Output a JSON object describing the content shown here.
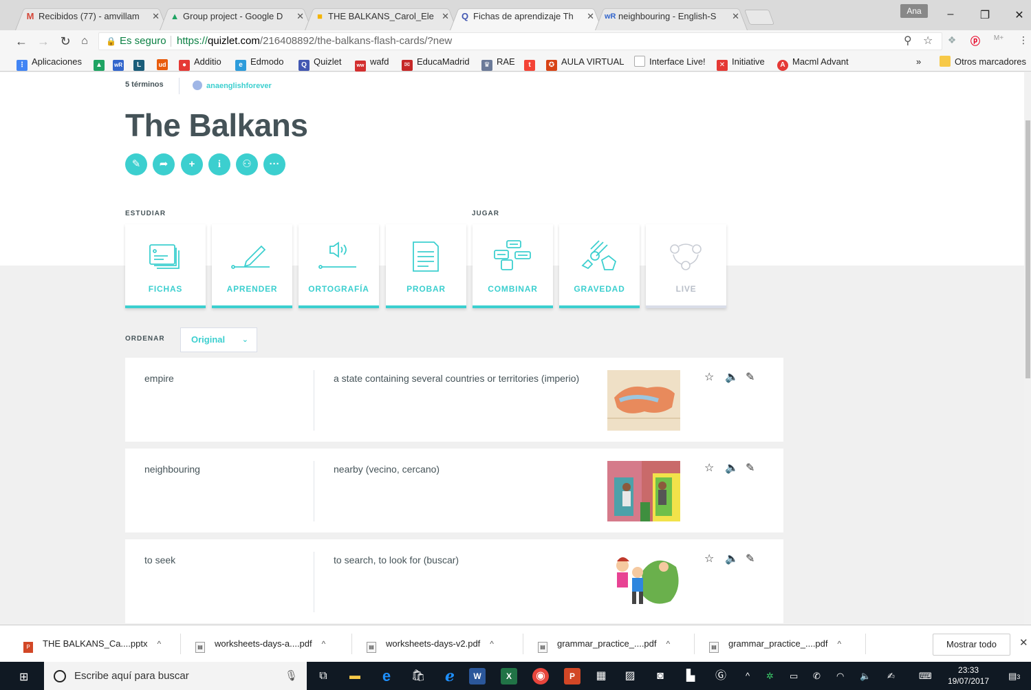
{
  "browser": {
    "tabs": [
      {
        "title": "Recibidos (77) - amvillam",
        "icon": "gmail-icon",
        "color": "#d44638",
        "active": false
      },
      {
        "title": "Group project - Google D",
        "icon": "drive-icon",
        "color": "#1fa463",
        "active": false
      },
      {
        "title": "THE BALKANS_Carol_Elen",
        "icon": "slides-icon",
        "color": "#f4b400",
        "active": false
      },
      {
        "title": "Fichas de aprendizaje Th",
        "icon": "quizlet-icon",
        "color": "#4257b2",
        "active": true
      },
      {
        "title": "neighbouring - English-S",
        "icon": "wordreference-icon",
        "color": "#3366cc",
        "active": false
      }
    ],
    "profile_name": "Ana",
    "secure_label": "Es seguro",
    "url_scheme": "https://",
    "url_domain": "quizlet.com",
    "url_path": "/216408892/the-balkans-flash-cards/?new",
    "bookmarks": [
      {
        "label": "Aplicaciones",
        "icon": "apps-grid-icon",
        "color": "#4285f4"
      },
      {
        "label": "",
        "icon": "drive-icon",
        "color": "#1fa463"
      },
      {
        "label": "",
        "icon": "wordreference-icon",
        "color": "#3366cc"
      },
      {
        "label": "",
        "icon": "linguee-icon",
        "color": "#1a5d7a"
      },
      {
        "label": "",
        "icon": "ud-icon",
        "color": "#e85c0d"
      },
      {
        "label": "Additio",
        "icon": "additio-icon",
        "color": "#e53935"
      },
      {
        "label": "Edmodo",
        "icon": "edmodo-icon",
        "color": "#2d9cdb"
      },
      {
        "label": "Quizlet",
        "icon": "quizlet-icon",
        "color": "#4257b2"
      },
      {
        "label": "wafd",
        "icon": "wafd-icon",
        "color": "#d32f2f"
      },
      {
        "label": "EducaMadrid",
        "icon": "educamadrid-icon",
        "color": "#c62828"
      },
      {
        "label": "RAE",
        "icon": "rae-icon",
        "color": "#6b7a99"
      },
      {
        "label": "",
        "icon": "t-icon",
        "color": "#f44336"
      },
      {
        "label": "AULA VIRTUAL",
        "icon": "aula-icon",
        "color": "#d84315"
      },
      {
        "label": "Interface Live!",
        "icon": "page-icon",
        "color": "#777777"
      },
      {
        "label": "Initiative",
        "icon": "initiative-icon",
        "color": "#e53935"
      },
      {
        "label": "Macml Advant",
        "icon": "macml-icon",
        "color": "#e53935"
      }
    ],
    "bookmarks_more": "»",
    "other_bookmarks": "Otros marcadores"
  },
  "page": {
    "term_count": "5 términos",
    "creator": "anaenglishforever",
    "title": "The Balkans",
    "study_label": "ESTUDIAR",
    "play_label": "JUGAR",
    "modes": [
      {
        "label": "FICHAS",
        "icon": "flashcards-icon"
      },
      {
        "label": "APRENDER",
        "icon": "learn-pencil-icon"
      },
      {
        "label": "ORTOGRAFÍA",
        "icon": "spell-speaker-icon"
      },
      {
        "label": "PROBAR",
        "icon": "test-document-icon"
      },
      {
        "label": "COMBINAR",
        "icon": "match-icon"
      },
      {
        "label": "GRAVEDAD",
        "icon": "gravity-asteroid-icon"
      },
      {
        "label": "LIVE",
        "icon": "live-icon"
      }
    ],
    "sort_label": "ORDENAR",
    "sort_value": "Original",
    "terms": [
      {
        "word": "empire",
        "definition": "a state containing several countries or territories (imperio)",
        "image": "empire-map-image"
      },
      {
        "word": "neighbouring",
        "definition": "nearby (vecino, cercano)",
        "image": "neighbours-image"
      },
      {
        "word": "to seek",
        "definition": "to search, to look for (buscar)",
        "image": "hide-and-seek-image"
      }
    ],
    "accent_color": "#3ccfcf",
    "text_color": "#455358"
  },
  "downloads": {
    "items": [
      {
        "name": "THE BALKANS_Ca....pptx",
        "type": "pptx"
      },
      {
        "name": "worksheets-days-a....pdf",
        "type": "pdf"
      },
      {
        "name": "worksheets-days-v2.pdf",
        "type": "pdf"
      },
      {
        "name": "grammar_practice_....pdf",
        "type": "pdf"
      },
      {
        "name": "grammar_practice_....pdf",
        "type": "pdf"
      }
    ],
    "show_all": "Mostrar todo"
  },
  "taskbar": {
    "search_placeholder": "Escribe aquí para buscar",
    "time": "23:33",
    "date": "19/07/2017",
    "notification_count": "3"
  }
}
